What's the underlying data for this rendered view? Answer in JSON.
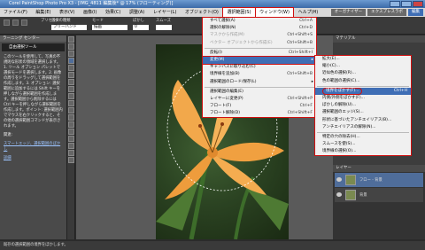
{
  "window": {
    "title": "Corel PaintShop Photo Pro X3 - [IMG_4811 編集後* @ 17% (フローティング)]"
  },
  "menubar": [
    "ファイル(F)",
    "編集(E)",
    "表示(V)",
    "画像(I)",
    "効果(C)",
    "調整(A)",
    "レイヤー(L)",
    "オブジェクト(O)",
    "選択範囲(S)",
    "ウィンドウ(W)",
    "ヘルプ(H)"
  ],
  "workspace_buttons": [
    "オーガナイザー",
    "エクスプレスラボ",
    "編集"
  ],
  "toolbar": {
    "preset_label": "プリセット",
    "mode_label": "選択の種類",
    "mode_value": "フリーハンド",
    "type_label": "モード",
    "type_value": "描画",
    "feather_label": "ぼかし",
    "feather_value": "0",
    "smooth_label": "スムーズ"
  },
  "learning_center": {
    "header": "ラーニング センター",
    "title": "自由選択ツール",
    "body": "このツールを使用して、写真の不規則な形状の領域を選択します。1. ツール オプション パレットで選択モードを選択します。2. 画像の周りをドラッグして選択範囲を作成します。3. オプション: 選択範囲に追加するには Shift キーを押しながら選択範囲を作成します。選択範囲から削除するには Ctrl キーを押しながら選択範囲を作成します。ポイント: 選択範囲内でマウスを右クリックすると、その他の選択範囲コマンドが表示されます。",
    "related_label": "関連:",
    "related_link": "スマートエッジ、選択範囲のぼかし",
    "help_link": "詳細"
  },
  "selection_menu": {
    "items": [
      {
        "label": "すべて選択(A)",
        "shortcut": "Ctrl+A",
        "disabled": false
      },
      {
        "label": "選択の解除(N)",
        "shortcut": "Ctrl+D",
        "disabled": false
      },
      {
        "label": "マスクから作成(M)",
        "shortcut": "Ctrl+Shift+S",
        "disabled": true
      },
      {
        "label": "ベクター オブジェクトから作成(E)",
        "shortcut": "Ctrl+Shift+B",
        "disabled": true
      },
      {
        "label": "反転(I)",
        "shortcut": "Ctrl+Shift+I",
        "disabled": false
      },
      {
        "label": "変更(M)",
        "shortcut": "",
        "disabled": false,
        "submenu": true,
        "selected": true
      },
      {
        "label": "キャンバスに取り込む(C)",
        "shortcut": "",
        "disabled": false
      },
      {
        "label": "境界線を追加(B)",
        "shortcut": "Ctrl+Shift+B",
        "disabled": false
      },
      {
        "label": "選択範囲のロード/保存(L)",
        "shortcut": "",
        "disabled": false,
        "submenu": true
      },
      {
        "label": "選択範囲の編集(E)",
        "shortcut": "",
        "disabled": false
      },
      {
        "label": "レイヤーに変更(P)",
        "shortcut": "Ctrl+Shift+P",
        "disabled": false
      },
      {
        "label": "フロート(F)",
        "shortcut": "Ctrl+F",
        "disabled": false
      },
      {
        "label": "フロート解除(D)",
        "shortcut": "Ctrl+Shift+F",
        "disabled": false
      }
    ]
  },
  "modify_submenu": {
    "items": [
      {
        "label": "拡大(E)...",
        "shortcut": ""
      },
      {
        "label": "縮小(C)...",
        "shortcut": ""
      },
      {
        "label": "近似色の選択(R)...",
        "shortcut": ""
      },
      {
        "label": "色の範囲の選択(C)...",
        "shortcut": ""
      },
      {
        "label": "境界をぼかす(F)...",
        "shortcut": "Ctrl+H",
        "selected": true
      },
      {
        "label": "内側/外側をぼかす(F)...",
        "shortcut": ""
      },
      {
        "label": "ぼかしの解除(U)...",
        "shortcut": ""
      },
      {
        "label": "選択範囲のエッジ(S)...",
        "shortcut": ""
      },
      {
        "label": "形状に基づいたアンチエイリアス(B)...",
        "shortcut": ""
      },
      {
        "label": "アンチエイリアスの解除(N)...",
        "shortcut": ""
      },
      {
        "label": "特定の穴の除去(H)...",
        "shortcut": ""
      },
      {
        "label": "スムースを使(S)...",
        "shortcut": ""
      },
      {
        "label": "境界線の選択(O)...",
        "shortcut": ""
      }
    ]
  },
  "right_panel": {
    "materials_header": "マテリアル",
    "layers_header": "レイヤー",
    "layers": [
      {
        "name": "フロー - 背景",
        "selected": true
      },
      {
        "name": "背景",
        "selected": false
      }
    ]
  },
  "statusbar": {
    "text": "既存の選択範囲の境界をぼかします。"
  },
  "colors": {
    "accent_red": "#d01010",
    "highlight_blue": "#3f6eb5"
  }
}
